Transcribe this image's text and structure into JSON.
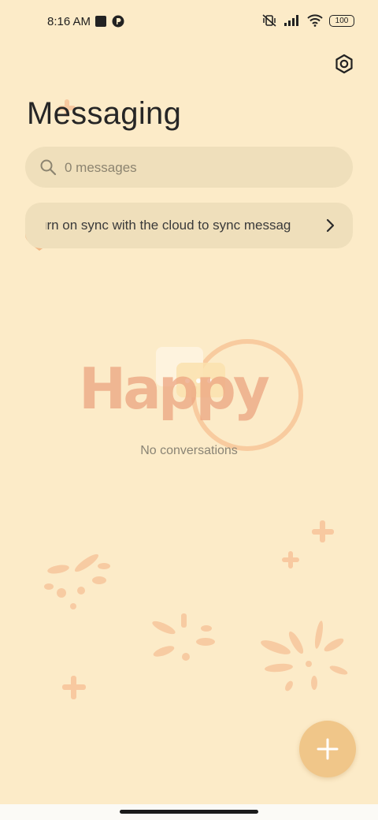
{
  "status_bar": {
    "time": "8:16 AM",
    "battery": "100",
    "icons": [
      "stop-icon",
      "app-notification-icon",
      "mute-vibrate-icon",
      "signal-icon",
      "wifi-icon",
      "battery-icon"
    ]
  },
  "header": {
    "title": "Messaging",
    "settings_icon": "settings-icon"
  },
  "search": {
    "placeholder": "0 messages"
  },
  "sync_banner": {
    "text": "urn on sync with the cloud to sync messag"
  },
  "empty_state": {
    "label": "No conversations",
    "icon": "chat-bubble-icon"
  },
  "fab": {
    "icon": "plus-icon"
  },
  "theme": {
    "background": "#fcebc8",
    "surface": "#efdfbb",
    "accent": "#f0c689",
    "decoration_text": "Happy"
  }
}
